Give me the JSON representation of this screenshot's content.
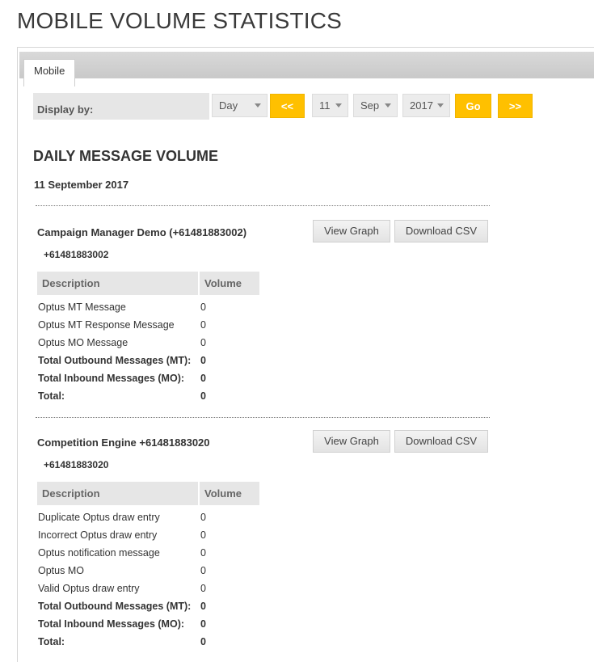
{
  "page": {
    "title": "MOBILE VOLUME STATISTICS"
  },
  "tabs": [
    {
      "label": "Mobile",
      "active": true
    }
  ],
  "controls": {
    "display_label": "Display by:",
    "period": {
      "value": "Day"
    },
    "prev_label": "<<",
    "day": {
      "value": "11"
    },
    "month": {
      "value": "Sep"
    },
    "year": {
      "value": "2017"
    },
    "go_label": "Go",
    "next_label": ">>"
  },
  "section": {
    "title": "DAILY MESSAGE VOLUME",
    "date": "11 September 2017"
  },
  "columns": {
    "description": "Description",
    "volume": "Volume"
  },
  "buttons": {
    "view_graph": "View Graph",
    "download_csv": "Download CSV"
  },
  "blocks": [
    {
      "title": "Campaign Manager Demo (+61481883002)",
      "number": "+61481883002",
      "rows": [
        {
          "description": "Optus MT Message",
          "volume": "0"
        },
        {
          "description": "Optus MT Response Message",
          "volume": "0"
        },
        {
          "description": "Optus MO Message",
          "volume": "0"
        }
      ],
      "totals": [
        {
          "description": "Total Outbound Messages (MT):",
          "volume": "0"
        },
        {
          "description": "Total Inbound Messages (MO):",
          "volume": "0"
        },
        {
          "description": "Total:",
          "volume": "0"
        }
      ]
    },
    {
      "title": "Competition Engine +61481883020",
      "number": "+61481883020",
      "rows": [
        {
          "description": "Duplicate Optus draw entry",
          "volume": "0"
        },
        {
          "description": "Incorrect Optus draw entry",
          "volume": "0"
        },
        {
          "description": "Optus notification message",
          "volume": "0"
        },
        {
          "description": "Optus MO",
          "volume": "0"
        },
        {
          "description": "Valid Optus draw entry",
          "volume": "0"
        }
      ],
      "totals": [
        {
          "description": "Total Outbound Messages (MT):",
          "volume": "0"
        },
        {
          "description": "Total Inbound Messages (MO):",
          "volume": "0"
        },
        {
          "description": "Total:",
          "volume": "0"
        }
      ]
    }
  ],
  "colors": {
    "accent": "#ffc000",
    "header_bg": "#e6e6e6"
  }
}
